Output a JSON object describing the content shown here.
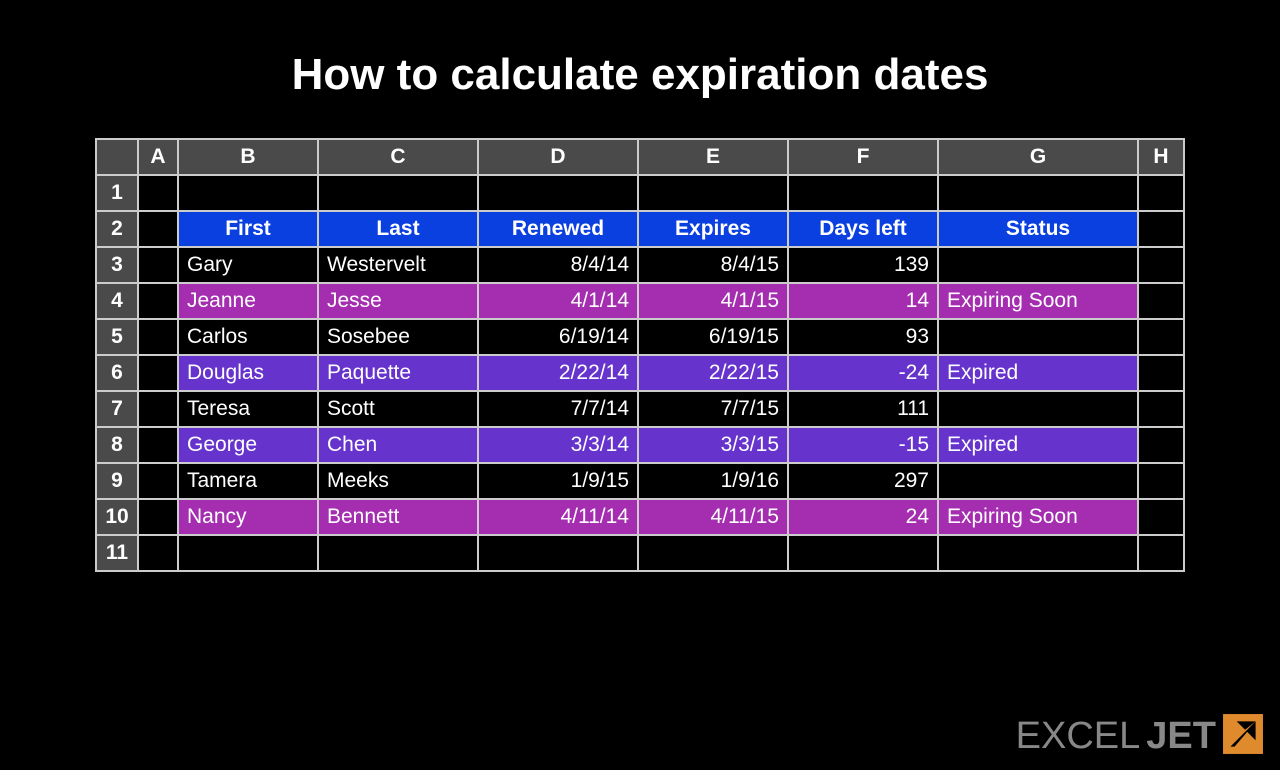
{
  "title": "How to calculate expiration dates",
  "columns": [
    "A",
    "B",
    "C",
    "D",
    "E",
    "F",
    "G",
    "H"
  ],
  "rownums": [
    "1",
    "2",
    "3",
    "4",
    "5",
    "6",
    "7",
    "8",
    "9",
    "10",
    "11"
  ],
  "headers": {
    "first": "First",
    "last": "Last",
    "renewed": "Renewed",
    "expires": "Expires",
    "daysleft": "Days left",
    "status": "Status"
  },
  "rows": [
    {
      "first": "Gary",
      "last": "Westervelt",
      "renewed": "8/4/14",
      "expires": "8/4/15",
      "daysleft": "139",
      "status": "",
      "style": ""
    },
    {
      "first": "Jeanne",
      "last": "Jesse",
      "renewed": "4/1/14",
      "expires": "4/1/15",
      "daysleft": "14",
      "status": "Expiring Soon",
      "style": "soon"
    },
    {
      "first": "Carlos",
      "last": "Sosebee",
      "renewed": "6/19/14",
      "expires": "6/19/15",
      "daysleft": "93",
      "status": "",
      "style": ""
    },
    {
      "first": "Douglas",
      "last": "Paquette",
      "renewed": "2/22/14",
      "expires": "2/22/15",
      "daysleft": "-24",
      "status": "Expired",
      "style": "exp"
    },
    {
      "first": "Teresa",
      "last": "Scott",
      "renewed": "7/7/14",
      "expires": "7/7/15",
      "daysleft": "111",
      "status": "",
      "style": ""
    },
    {
      "first": "George",
      "last": "Chen",
      "renewed": "3/3/14",
      "expires": "3/3/15",
      "daysleft": "-15",
      "status": "Expired",
      "style": "exp"
    },
    {
      "first": "Tamera",
      "last": "Meeks",
      "renewed": "1/9/15",
      "expires": "1/9/16",
      "daysleft": "297",
      "status": "",
      "style": ""
    },
    {
      "first": "Nancy",
      "last": "Bennett",
      "renewed": "4/11/14",
      "expires": "4/11/15",
      "daysleft": "24",
      "status": "Expiring Soon",
      "style": "soon"
    }
  ],
  "brand": {
    "part1": "EXCEL",
    "part2": "JET"
  }
}
